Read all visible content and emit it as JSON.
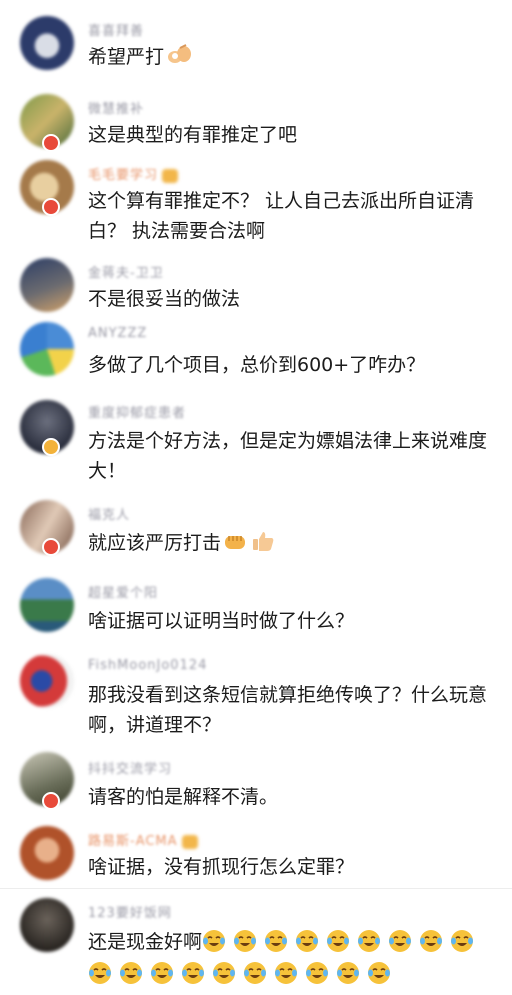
{
  "comments": [
    {
      "username": "喜喜拜善",
      "text": "希望严打",
      "emoji": "ok-hand"
    },
    {
      "username": "微慧推补",
      "text": "这是典型的有罪推定了吧"
    },
    {
      "username": "毛毛要学习",
      "text": "这个算有罪推定不？ 让人自己去派出所自证清白？ 执法需要合法啊"
    },
    {
      "username": "金蒋夫-卫卫",
      "text": "不是很妥当的做法"
    },
    {
      "username": "ANYZZZ",
      "text": "多做了几个项目，总价到600+了咋办？"
    },
    {
      "username": "重度抑郁症患者",
      "text": "方法是个好方法，但是定为嫖娼法律上来说难度大！"
    },
    {
      "username": "福克人",
      "text": "就应该严厉打击",
      "emoji": "fist-thumbs"
    },
    {
      "username": "超星爱个阳",
      "text": "啥证据可以证明当时做了什么？"
    },
    {
      "username": "FishMoonJo0124",
      "text": "那我没看到这条短信就算拒绝传唤了？什么玩意啊，讲道理不？"
    },
    {
      "username": "抖抖交流学习",
      "text": "请客的怕是解释不清。"
    },
    {
      "username": "路易斯-ACMA",
      "text": "啥证据，没有抓现行怎么定罪？"
    },
    {
      "username": "123要好饭网",
      "text": "还是现金好啊",
      "cry_count": 19
    }
  ],
  "colors": {
    "username": "#9a9aa6",
    "username_highlight": "#e8956a",
    "text": "#1c1c1c",
    "badge_red": "#e84a3a",
    "badge_gold": "#f3b23a"
  }
}
